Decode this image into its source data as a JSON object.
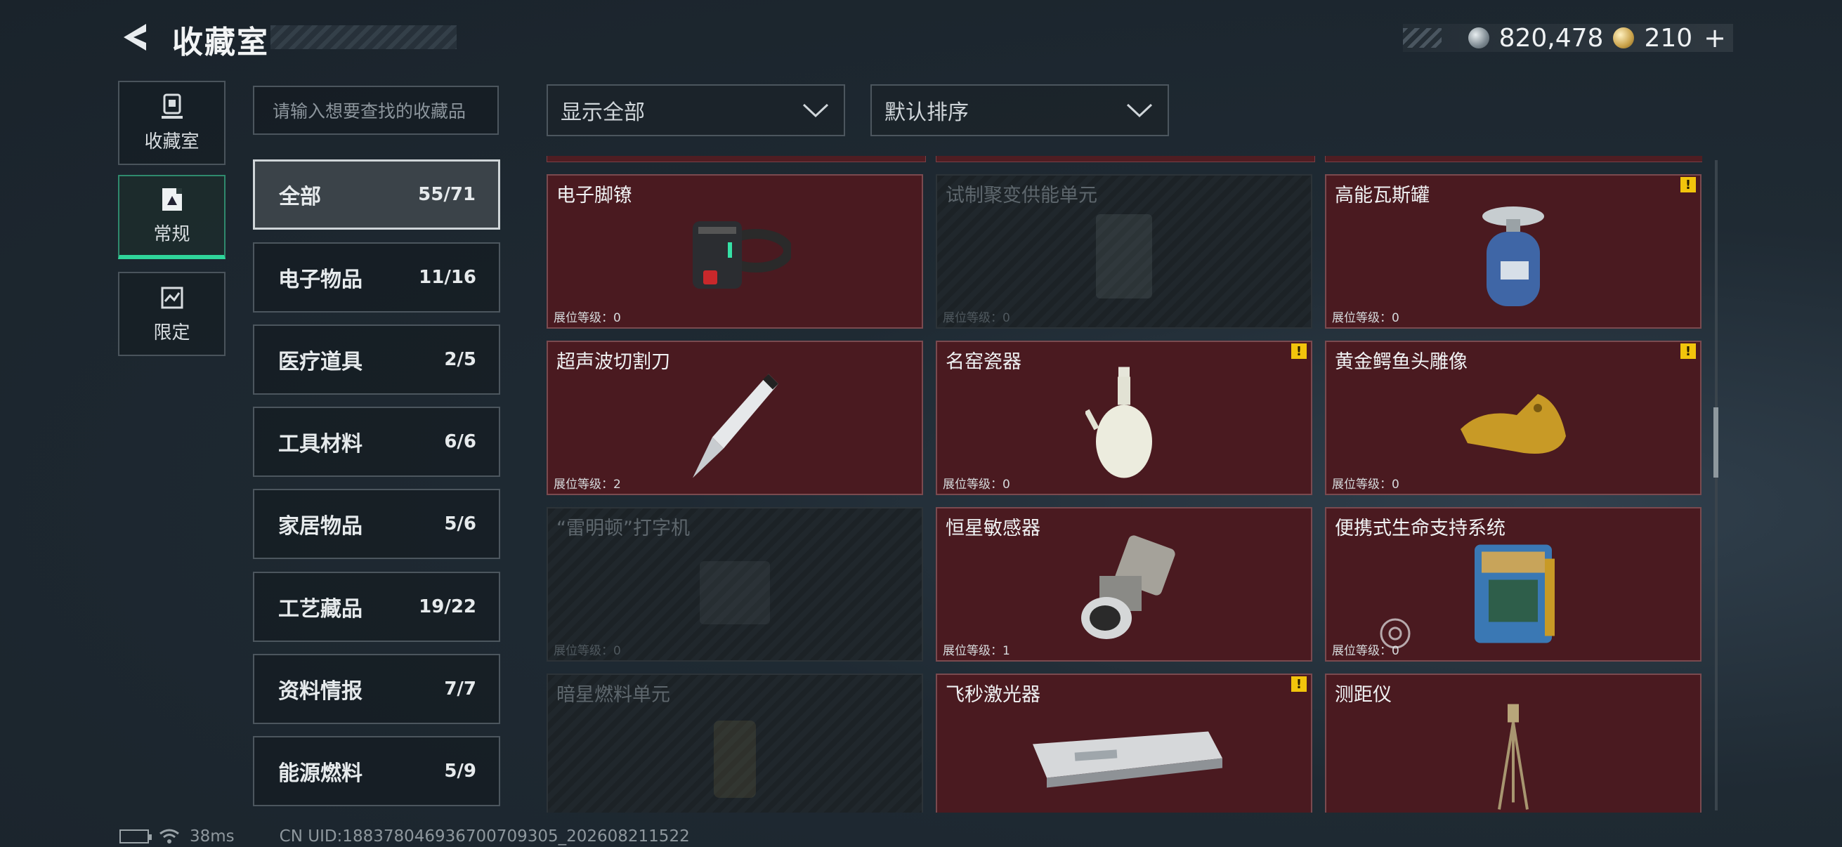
{
  "header": {
    "title": "收藏室",
    "currencies": [
      {
        "icon": "silver-coin-icon",
        "value": "820,478"
      },
      {
        "icon": "gold-coin-icon",
        "value": "210",
        "suffix": "+"
      }
    ]
  },
  "nav": [
    {
      "label": "收藏室",
      "icon": "trophy-icon"
    },
    {
      "label": "常规",
      "icon": "frame-icon",
      "active": true
    },
    {
      "label": "限定",
      "icon": "map-icon"
    }
  ],
  "search": {
    "placeholder": "请输入想要查找的收藏品"
  },
  "categories": [
    {
      "name": "全部",
      "count": "55/71",
      "active": true
    },
    {
      "name": "电子物品",
      "count": "11/16"
    },
    {
      "name": "医疗道具",
      "count": "2/5"
    },
    {
      "name": "工具材料",
      "count": "6/6"
    },
    {
      "name": "家居物品",
      "count": "5/6"
    },
    {
      "name": "工艺藏品",
      "count": "19/22"
    },
    {
      "name": "资料情报",
      "count": "7/7"
    },
    {
      "name": "能源燃料",
      "count": "5/9"
    }
  ],
  "filters": {
    "show": "显示全部",
    "sort": "默认排序"
  },
  "items": [
    {
      "name": "电子脚镣",
      "level": "展位等级：0",
      "locked": false,
      "warn": false,
      "art": "ankle-monitor"
    },
    {
      "name": "试制聚变供能单元",
      "level": "展位等级：0",
      "locked": true,
      "warn": false,
      "art": "fusion"
    },
    {
      "name": "高能瓦斯罐",
      "level": "展位等级：0",
      "locked": false,
      "warn": true,
      "art": "gas-tank"
    },
    {
      "name": "超声波切割刀",
      "level": "展位等级：2",
      "locked": false,
      "warn": false,
      "art": "knife"
    },
    {
      "name": "名窑瓷器",
      "level": "展位等级：0",
      "locked": false,
      "warn": true,
      "art": "vase"
    },
    {
      "name": "黄金鳄鱼头雕像",
      "level": "展位等级：0",
      "locked": false,
      "warn": true,
      "art": "croc"
    },
    {
      "name": "“雷明顿”打字机",
      "level": "展位等级：0",
      "locked": true,
      "warn": false,
      "art": "typewriter"
    },
    {
      "name": "恒星敏感器",
      "level": "展位等级：1",
      "locked": false,
      "warn": false,
      "art": "sensor"
    },
    {
      "name": "便携式生命支持系统",
      "level": "展位等级：0",
      "locked": false,
      "warn": false,
      "art": "life-support"
    },
    {
      "name": "暗星燃料单元",
      "level": "",
      "locked": true,
      "warn": false,
      "art": "fuel"
    },
    {
      "name": "飞秒激光器",
      "level": "",
      "locked": false,
      "warn": true,
      "art": "laser"
    },
    {
      "name": "测距仪",
      "level": "",
      "locked": false,
      "warn": false,
      "art": "rangefinder"
    }
  ],
  "footer": {
    "ping": "38ms",
    "uid": "CN UID:18837804693670070930­5_202608211522"
  },
  "colors": {
    "card_bg": "#4a1a20",
    "card_border": "#7a4a4f",
    "accent_green": "#2fd59a",
    "warn_yellow": "#f2c40c"
  }
}
